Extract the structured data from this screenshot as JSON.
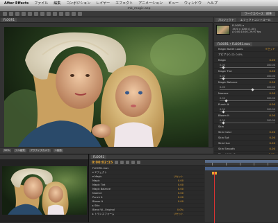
{
  "app": {
    "name": "After Effects",
    "menu": [
      "ファイル",
      "編集",
      "コンポジション",
      "レイヤー",
      "エフェクト",
      "アニメーション",
      "ビュー",
      "ウィンドウ",
      "ヘルプ"
    ],
    "clock": "",
    "window_title": "mb_magic.aep"
  },
  "toolbar": {
    "workspace": "ワークスペース : 標準"
  },
  "comp_panel": {
    "tab": "FLOOR1",
    "footer": [
      "50%",
      "フル画質",
      "アクティブカメラ",
      "1画面"
    ]
  },
  "project_panel": {
    "tab": "プロジェクト",
    "tab2": "エフェクトコントロール",
    "item_name": "FLOOR1 ▾",
    "item_info": [
      "1920 x 1080 (1.00)",
      "Δ 0:00:10:00, 29.97 fps"
    ]
  },
  "effects_panel": {
    "tab": "FLOOR1 • FLOOR1.mov",
    "params": [
      {
        "label": "Magic Bullet Looks",
        "value": "リセット"
      },
      {
        "label": "アピアランス: 0.0%",
        "value": ""
      },
      {
        "label": "Magic",
        "value": "0.00"
      },
      {
        "label": "",
        "min": "0.00",
        "max": "100.00",
        "pos": 0.05
      },
      {
        "label": "Magic Tint",
        "value": "0.00"
      },
      {
        "label": "",
        "min": "0.00",
        "max": "100.00",
        "pos": 0.05
      },
      {
        "label": "Magic Balance",
        "value": "0.00"
      },
      {
        "label": "",
        "min": "0.00",
        "max": "100.00",
        "pos": 0.6
      },
      {
        "label": "Nuance",
        "value": "0.00"
      },
      {
        "label": "",
        "min": "0.00",
        "max": "100.00",
        "pos": 0.1
      },
      {
        "label": "Punch It",
        "value": "0.00"
      },
      {
        "label": "",
        "min": "0.00",
        "max": "100.00",
        "pos": 0.05
      },
      {
        "label": "Bloom It",
        "value": "0.00"
      },
      {
        "label": "",
        "min": "0.00",
        "max": "100.00",
        "pos": 0.05
      },
      {
        "label": "Skin",
        "value": ""
      },
      {
        "label": "Skin Color",
        "value": "0.00"
      },
      {
        "label": "Skin Sat",
        "value": "0.00"
      },
      {
        "label": "Skin Hue",
        "value": "0.00"
      },
      {
        "label": "Skin Smooth",
        "value": "0.00"
      },
      {
        "label": "Blend With O.",
        "value": "0.0%"
      }
    ]
  },
  "timeline": {
    "tab": "FLOOR1",
    "timecode": "0:00:02:15",
    "layers": [
      {
        "name": "FLOOR1.mov",
        "value": ""
      },
      {
        "name": "▾ エフェクト",
        "value": ""
      },
      {
        "name": "▾ Magic",
        "value": "リセット"
      },
      {
        "name": "Magic",
        "value": "0.00"
      },
      {
        "name": "Magic Tint",
        "value": "0.00"
      },
      {
        "name": "Magic Balance",
        "value": "0.00"
      },
      {
        "name": "Nuance",
        "value": "0.00"
      },
      {
        "name": "Punch It",
        "value": "0.00"
      },
      {
        "name": "Bloom It",
        "value": "0.00"
      },
      {
        "name": "▸ Skin",
        "value": ""
      },
      {
        "name": "Blend W...Original",
        "value": "0.0%"
      },
      {
        "name": "▸ トランスフォーム",
        "value": "リセット"
      }
    ],
    "cti_position": 0.12
  },
  "colors": {
    "accent": "#e6a530",
    "cti": "#dd3333",
    "track": "#4f6ea0"
  }
}
